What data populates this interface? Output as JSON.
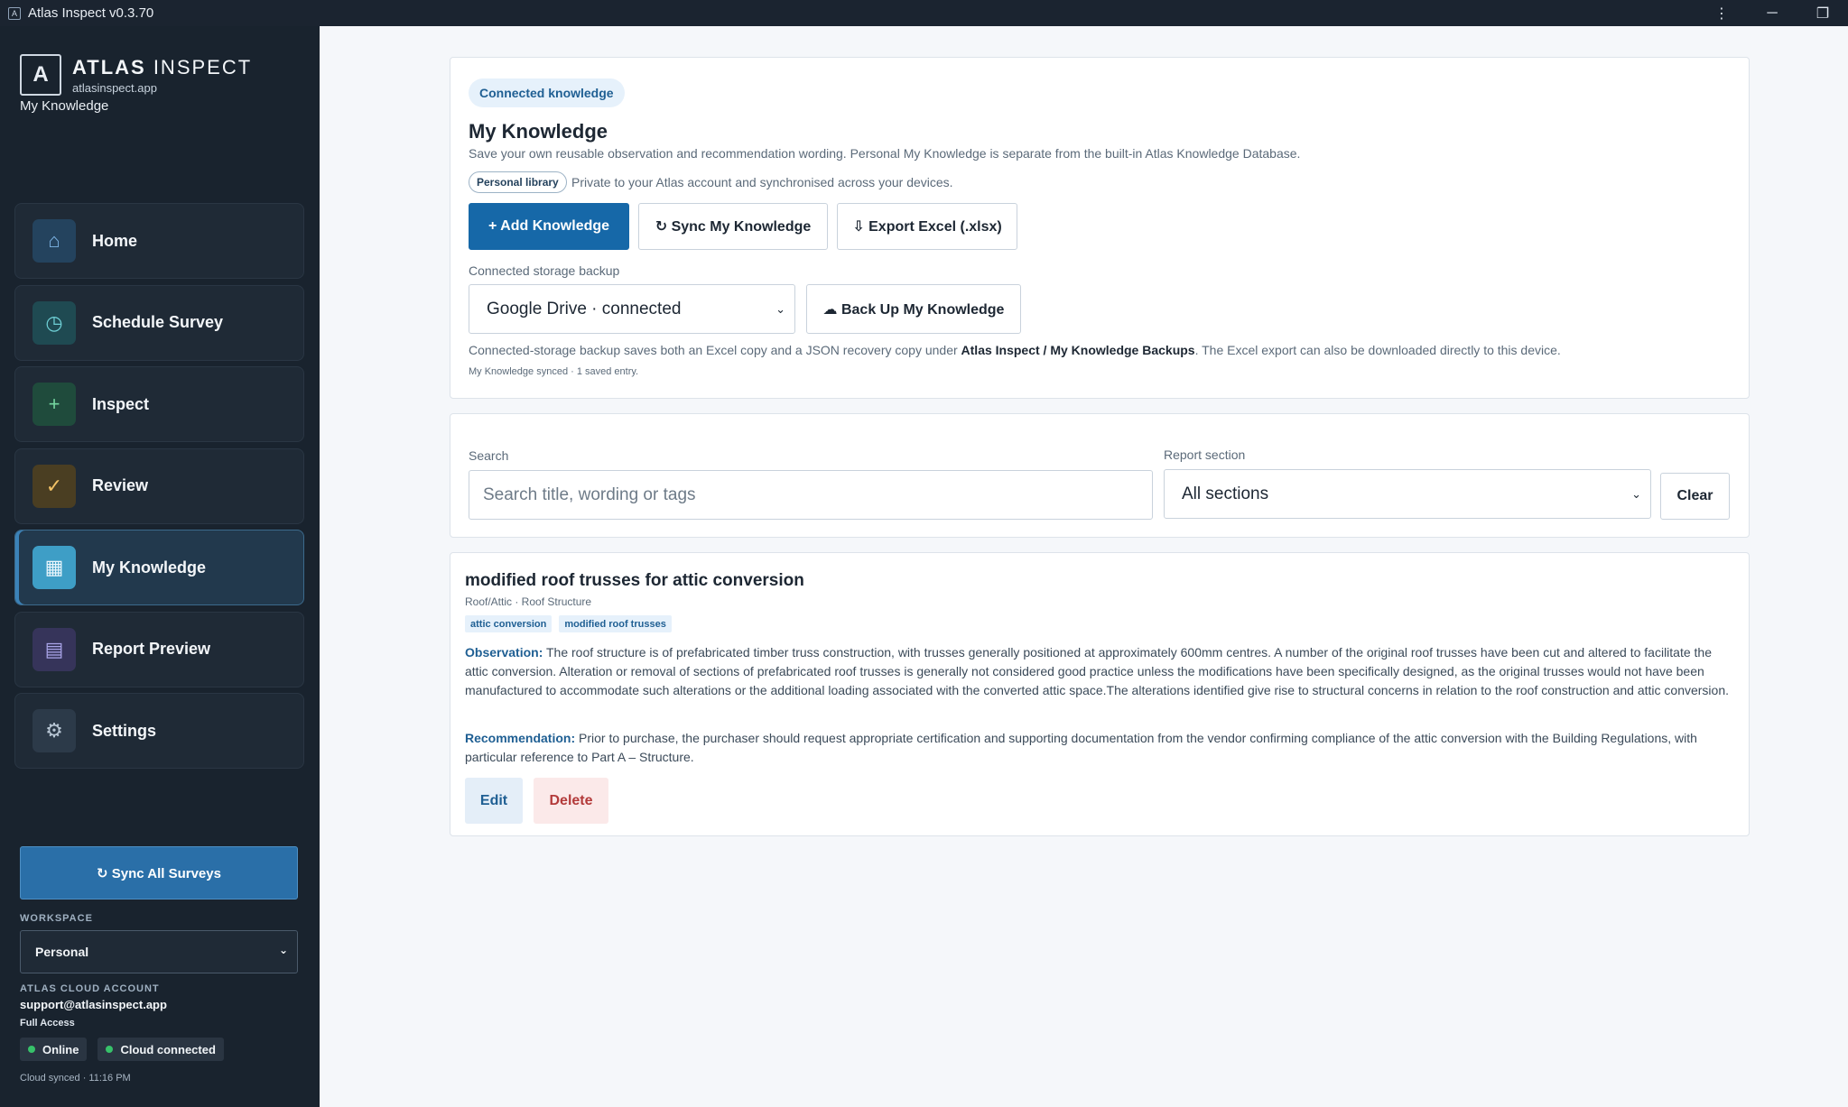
{
  "window": {
    "title": "Atlas Inspect v0.3.70",
    "app_icon": "A"
  },
  "brand": {
    "logo": "A",
    "name_bold": "ATLAS",
    "name_light": " INSPECT",
    "url": "atlasinspect.app",
    "subtitle": "My Knowledge"
  },
  "nav": {
    "items": [
      {
        "label": "Home",
        "icon": "house-icon",
        "glyph": "⌂"
      },
      {
        "label": "Schedule Survey",
        "icon": "clock-icon",
        "glyph": "◷"
      },
      {
        "label": "Inspect",
        "icon": "plus-icon",
        "glyph": "+"
      },
      {
        "label": "Review",
        "icon": "check-icon",
        "glyph": "✓"
      },
      {
        "label": "My Knowledge",
        "icon": "grid-icon",
        "glyph": "▦",
        "active": true
      },
      {
        "label": "Report Preview",
        "icon": "document-icon",
        "glyph": "▤"
      },
      {
        "label": "Settings",
        "icon": "gear-icon",
        "glyph": "⚙"
      }
    ]
  },
  "sidebar_bottom": {
    "sync_all_label": "↻ Sync All Surveys",
    "workspace_label": "WORKSPACE",
    "workspace_value": "Personal",
    "account_label": "ATLAS CLOUD ACCOUNT",
    "account_email": "support@atlasinspect.app",
    "account_access": "Full Access",
    "status_online": "Online",
    "status_cloud": "Cloud connected",
    "cloud_synced": "Cloud synced · 11:16 PM",
    "status_color": "#37c26a"
  },
  "knowledge": {
    "chip": "Connected knowledge",
    "title": "My Knowledge",
    "description": "Save your own reusable observation and recommendation wording. Personal My Knowledge is separate from the built-in Atlas Knowledge Database.",
    "library_chip": "Personal library",
    "library_text": "Private to your Atlas account and synchronised across your devices.",
    "add_label": "+ Add Knowledge",
    "sync_label": "↻ Sync My Knowledge",
    "export_label": "⇩ Export Excel (.xlsx)",
    "storage_label": "Connected storage backup",
    "storage_value": "Google Drive · connected",
    "backup_label": "☁ Back Up My Knowledge",
    "backup_note_pre": "Connected-storage backup saves both an Excel copy and a JSON recovery copy under ",
    "backup_note_path": "Atlas Inspect / My Knowledge Backups",
    "backup_note_post": ". The Excel export can also be downloaded directly to this device.",
    "synced_note": "My Knowledge synced · 1 saved entry.",
    "accent_color": "#1668a8"
  },
  "search": {
    "label": "Search",
    "placeholder": "Search title, wording or tags",
    "value": "",
    "section_label": "Report section",
    "section_value": "All sections",
    "clear_label": "Clear"
  },
  "entry": {
    "title": "modified roof trusses for attic conversion",
    "section": "Roof/Attic · Roof Structure",
    "tags": [
      "attic conversion",
      "modified roof trusses"
    ],
    "observation_label": "Observation:",
    "observation": " The roof structure is of prefabricated timber truss construction, with trusses generally positioned at approximately 600mm centres. A number of the original roof trusses have been cut and altered to facilitate the attic conversion. Alteration or removal of sections of prefabricated roof trusses is generally not considered good practice unless the modifications have been specifically designed, as the original trusses would not have been manufactured to accommodate such alterations or the additional loading associated with the converted attic space.The alterations identified give rise to structural concerns in relation to the roof construction and attic conversion.",
    "recommendation_label": "Recommendation:",
    "recommendation": " Prior to purchase, the purchaser should request appropriate certification and supporting documentation from the vendor confirming compliance of the attic conversion with the Building Regulations, with particular reference to Part A – Structure.",
    "edit_label": "Edit",
    "delete_label": "Delete"
  }
}
